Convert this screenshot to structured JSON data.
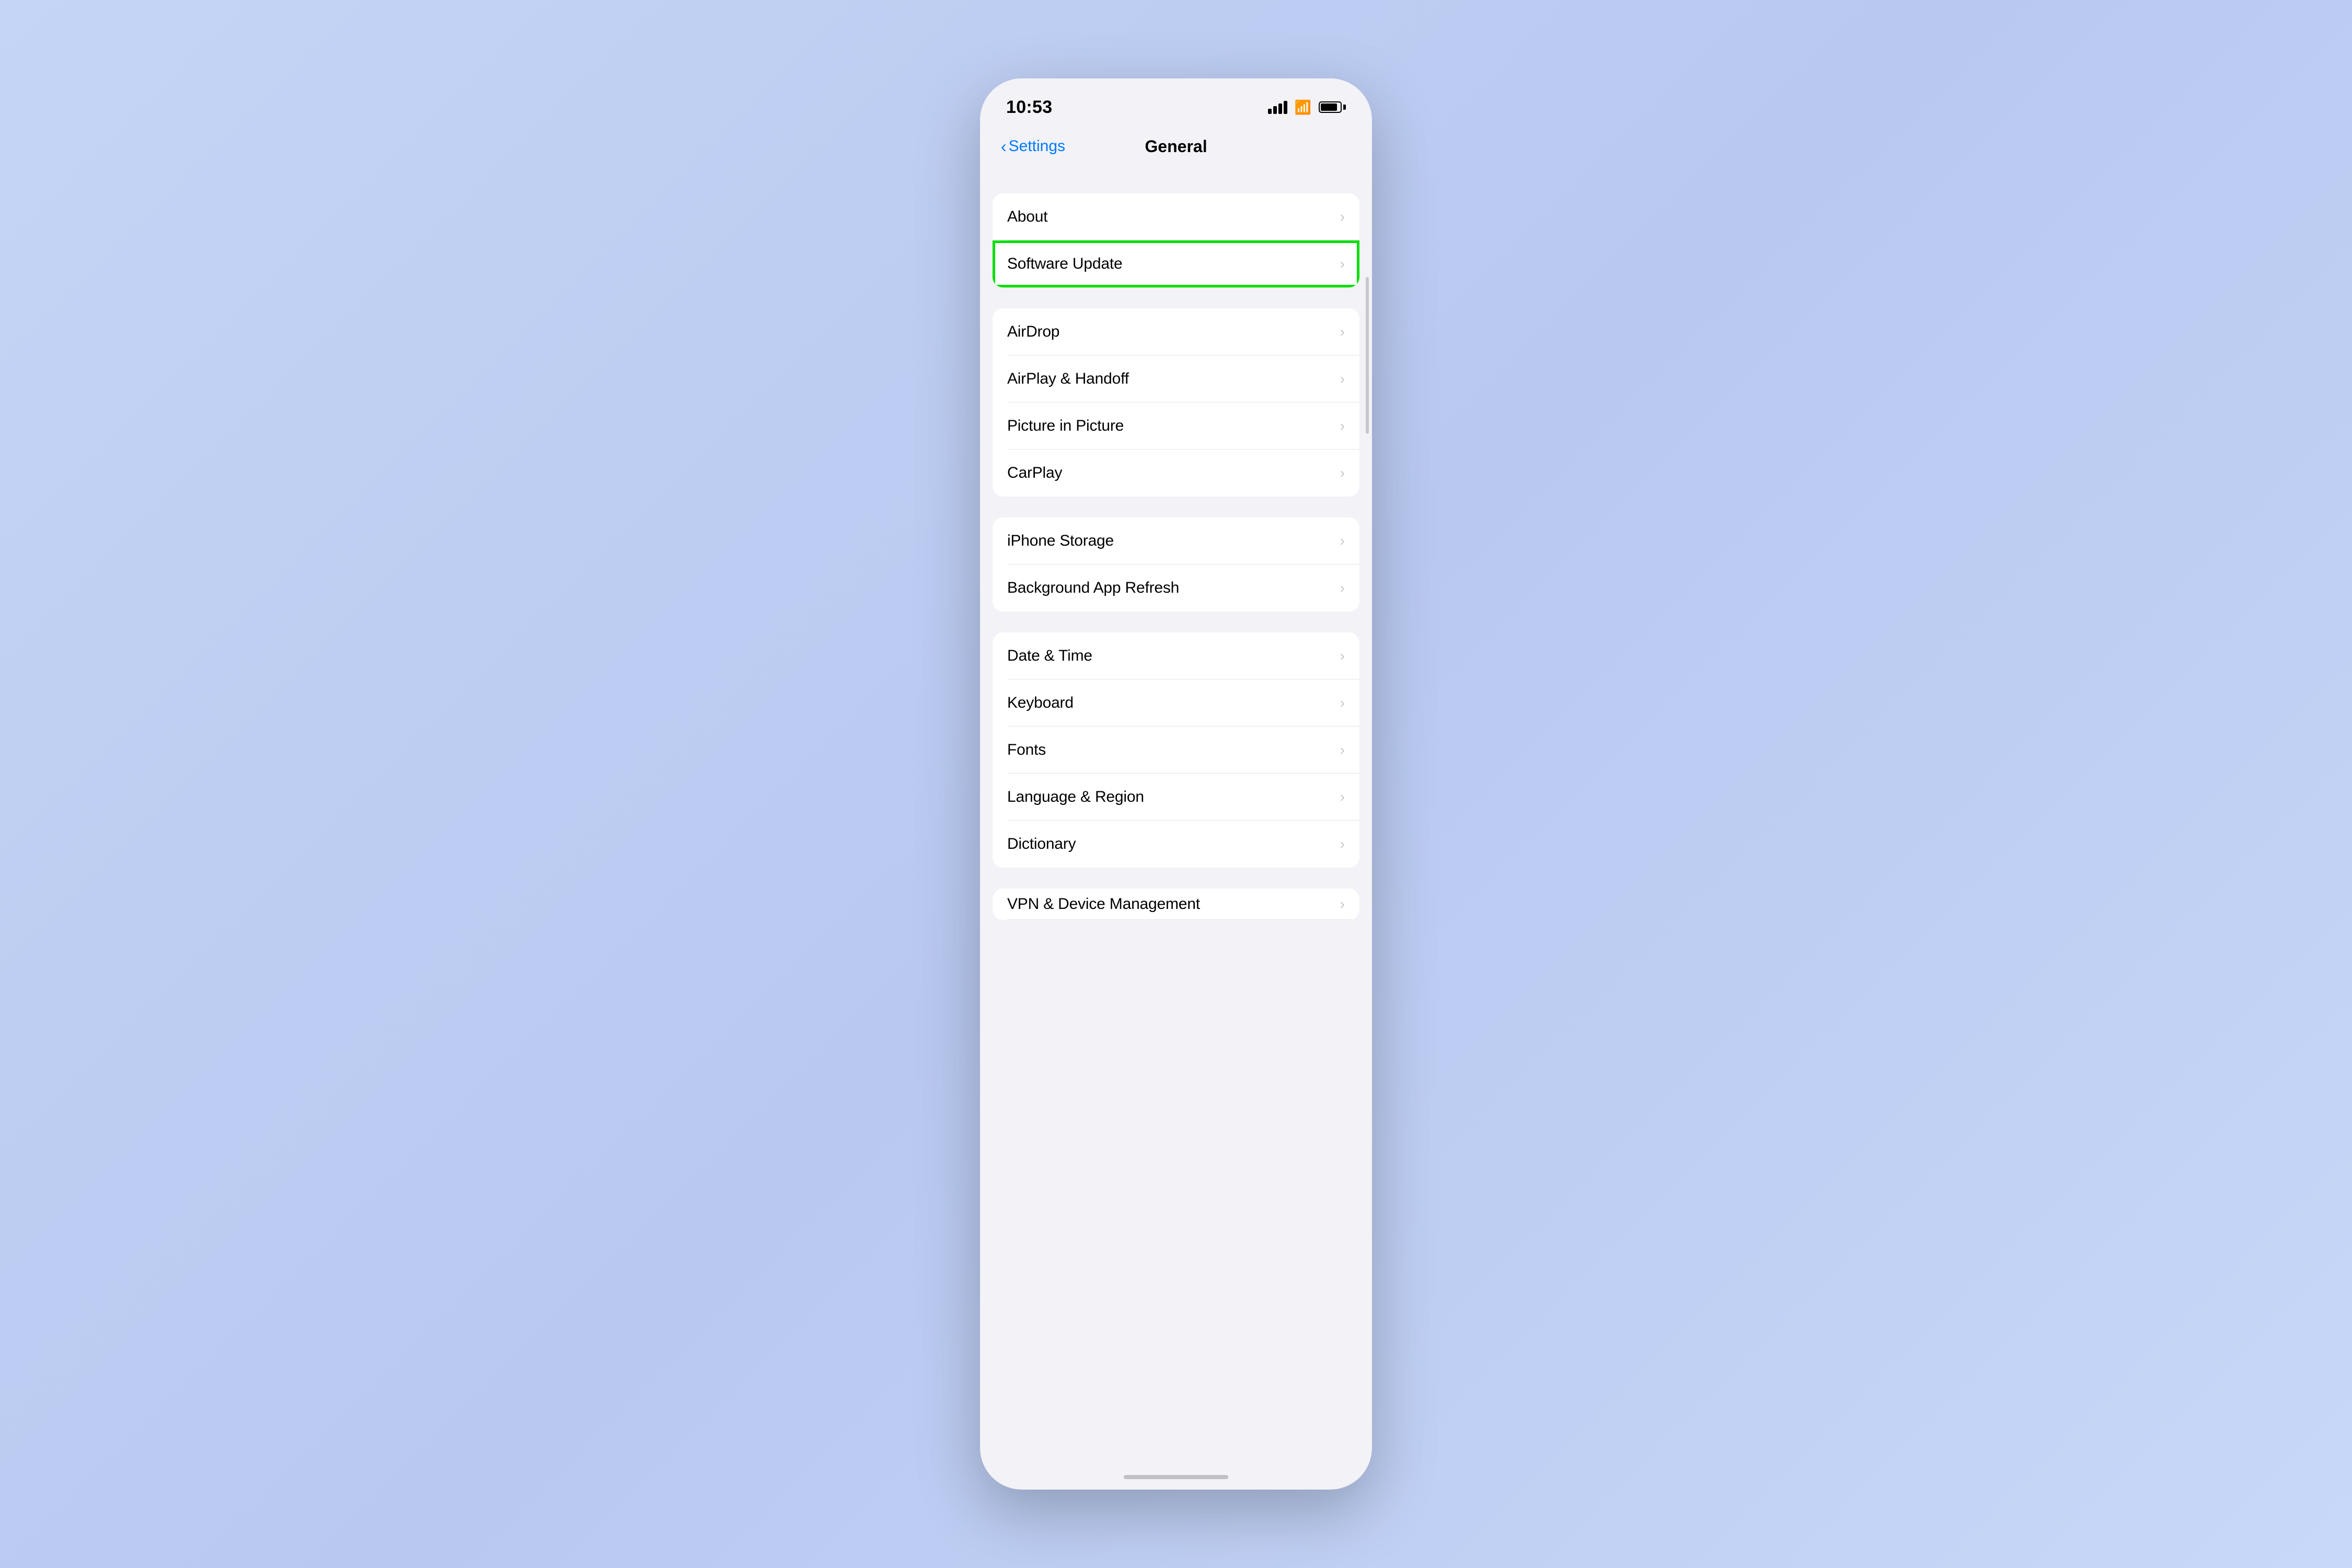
{
  "statusBar": {
    "time": "10:53",
    "batteryLevel": 85
  },
  "navigation": {
    "backLabel": "Settings",
    "title": "General"
  },
  "sections": [
    {
      "id": "section1",
      "items": [
        {
          "id": "about",
          "label": "About",
          "highlighted": false
        },
        {
          "id": "software-update",
          "label": "Software Update",
          "highlighted": true
        }
      ]
    },
    {
      "id": "section2",
      "items": [
        {
          "id": "airdrop",
          "label": "AirDrop",
          "highlighted": false
        },
        {
          "id": "airplay-handoff",
          "label": "AirPlay & Handoff",
          "highlighted": false
        },
        {
          "id": "picture-in-picture",
          "label": "Picture in Picture",
          "highlighted": false
        },
        {
          "id": "carplay",
          "label": "CarPlay",
          "highlighted": false
        }
      ]
    },
    {
      "id": "section3",
      "items": [
        {
          "id": "iphone-storage",
          "label": "iPhone Storage",
          "highlighted": false
        },
        {
          "id": "background-app-refresh",
          "label": "Background App Refresh",
          "highlighted": false
        }
      ]
    },
    {
      "id": "section4",
      "items": [
        {
          "id": "date-time",
          "label": "Date & Time",
          "highlighted": false
        },
        {
          "id": "keyboard",
          "label": "Keyboard",
          "highlighted": false
        },
        {
          "id": "fonts",
          "label": "Fonts",
          "highlighted": false
        },
        {
          "id": "language-region",
          "label": "Language & Region",
          "highlighted": false
        },
        {
          "id": "dictionary",
          "label": "Dictionary",
          "highlighted": false
        }
      ]
    }
  ],
  "partialSection": {
    "label": "VPN & Device Management"
  },
  "chevron": "›",
  "colors": {
    "background": "#b8c8f0",
    "cardBackground": "#ffffff",
    "highlight": "#00e000",
    "accent": "#007aff",
    "text": "#000000",
    "secondaryText": "#c7c7cc",
    "separator": "#e5e5ea"
  }
}
